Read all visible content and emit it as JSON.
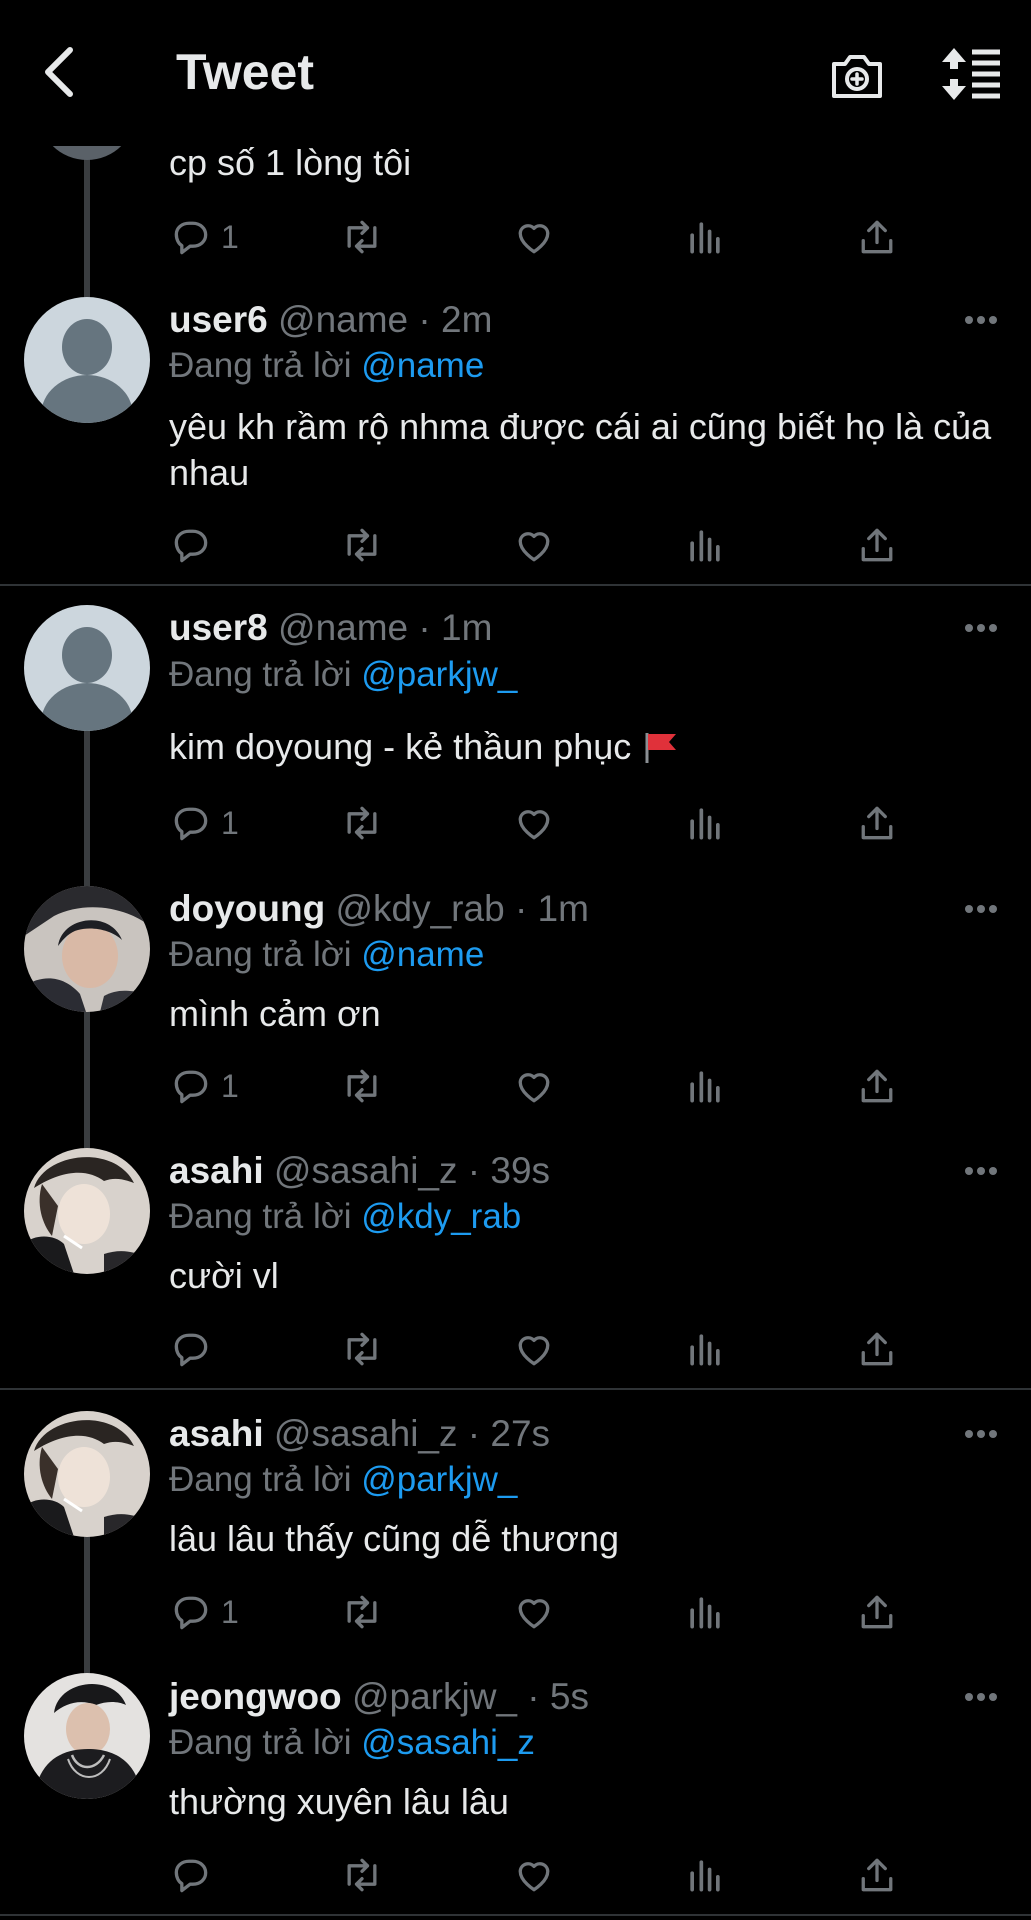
{
  "header": {
    "title": "Tweet"
  },
  "reply_prefix": "Đang trả lời",
  "top_tweet": {
    "content": "cp số 1 lòng tôi",
    "reply_count": "1"
  },
  "tweets": [
    {
      "name": "user6",
      "handle": "@name",
      "time": "· 2m",
      "replying_to": "@name",
      "content": "yêu kh rầm rộ nhma được cái ai cũng biết họ là của nhau",
      "reply_count": ""
    },
    {
      "name": "user8",
      "handle": "@name",
      "time": "· 1m",
      "replying_to": "@parkjw_",
      "content": "kim doyoung - kẻ thầun phục",
      "reply_count": "1"
    },
    {
      "name": "doyoung",
      "handle": "@kdy_rab",
      "time": "· 1m",
      "replying_to": "@name",
      "content": "mình cảm ơn",
      "reply_count": "1"
    },
    {
      "name": "asahi",
      "handle": "@sasahi_z",
      "time": "· 39s",
      "replying_to": "@kdy_rab",
      "content": "cười vl",
      "reply_count": ""
    },
    {
      "name": "asahi",
      "handle": "@sasahi_z",
      "time": "· 27s",
      "replying_to": "@parkjw_",
      "content": "lâu lâu thấy cũng dễ thương",
      "reply_count": "1"
    },
    {
      "name": "jeongwoo",
      "handle": "@parkjw_",
      "time": "· 5s",
      "replying_to": "@sasahi_z",
      "content": "thường xuyên lâu lâu",
      "reply_count": ""
    }
  ],
  "colors": {
    "background": "#000000",
    "text": "#e7e9ea",
    "muted": "#71767b",
    "link": "#1d9bf0",
    "divider": "#2f3336"
  },
  "icons": [
    "back-arrow-icon",
    "camera-add-icon",
    "sort-icon",
    "reply-icon",
    "retweet-icon",
    "like-icon",
    "views-icon",
    "share-icon",
    "more-icon",
    "red-flag-emoji"
  ]
}
